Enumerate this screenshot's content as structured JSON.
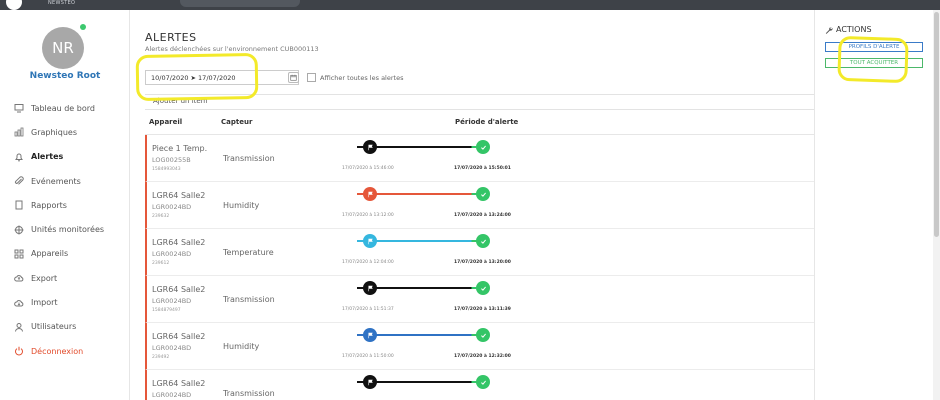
{
  "app": {
    "brand": "NEWSTEO"
  },
  "user": {
    "initials": "NR",
    "name": "Newsteo Root"
  },
  "nav": [
    {
      "label": "Tableau de bord",
      "icon": "monitor-icon",
      "name": "sidebar-item-dashboard"
    },
    {
      "label": "Graphiques",
      "icon": "bar-chart-icon",
      "name": "sidebar-item-graphs"
    },
    {
      "label": "Alertes",
      "icon": "bell-icon",
      "name": "sidebar-item-alerts",
      "active": true
    },
    {
      "label": "Evénements",
      "icon": "paperclip-icon",
      "name": "sidebar-item-events"
    },
    {
      "label": "Rapports",
      "icon": "document-icon",
      "name": "sidebar-item-reports"
    },
    {
      "label": "Unités monitorées",
      "icon": "crosshair-icon",
      "name": "sidebar-item-units"
    },
    {
      "label": "Appareils",
      "icon": "grid-icon",
      "name": "sidebar-item-devices"
    },
    {
      "label": "Export",
      "icon": "cloud-upload-icon",
      "name": "sidebar-item-export"
    },
    {
      "label": "Import",
      "icon": "cloud-download-icon",
      "name": "sidebar-item-import"
    },
    {
      "label": "Utilisateurs",
      "icon": "user-icon",
      "name": "sidebar-item-users"
    },
    {
      "label": "Déconnexion",
      "icon": "power-icon",
      "name": "sidebar-item-logout",
      "logout": true
    }
  ],
  "main": {
    "title": "ALERTES",
    "subtitle": "Alertes déclenchées sur l'environnement CUB000113",
    "date_range": "10/07/2020 ➤ 17/07/2020",
    "show_all_label": "Afficher toutes les alertes",
    "add_item": "Ajouter un item",
    "columns": {
      "device": "Appareil",
      "sensor": "Capteur",
      "period": "Période d'alerte"
    }
  },
  "alerts": [
    {
      "device": "Piece 1 Temp.",
      "code": "LOG00255B",
      "id": "1584993043",
      "sensor": "Transmission",
      "start_color": "#111111",
      "line_color": "#111111",
      "start": "17/07/2020 à 15:46:00",
      "end": "17/07/2020 à 15:50:01"
    },
    {
      "device": "LGR64 Salle2",
      "code": "LGR0024BD",
      "id": "239632",
      "sensor": "Humidity",
      "start_color": "#e5573a",
      "line_color": "#e5573a",
      "start": "17/07/2020 à 13:12:00",
      "end": "17/07/2020 à 13:24:00"
    },
    {
      "device": "LGR64 Salle2",
      "code": "LGR0024BD",
      "id": "239612",
      "sensor": "Temperature",
      "start_color": "#35b7df",
      "line_color": "#35b7df",
      "start": "17/07/2020 à 12:04:00",
      "end": "17/07/2020 à 13:20:00"
    },
    {
      "device": "LGR64 Salle2",
      "code": "LGR0024BD",
      "id": "1584879497",
      "sensor": "Transmission",
      "start_color": "#111111",
      "line_color": "#111111",
      "start": "17/07/2020 à 11:51:37",
      "end": "17/07/2020 à 13:11:39"
    },
    {
      "device": "LGR64 Salle2",
      "code": "LGR0024BD",
      "id": "239492",
      "sensor": "Humidity",
      "start_color": "#2f72c4",
      "line_color": "#2f72c4",
      "start": "17/07/2020 à 11:50:00",
      "end": "17/07/2020 à 12:32:00"
    },
    {
      "device": "LGR64 Salle2",
      "code": "LGR0024BD",
      "id": "",
      "sensor": "Transmission",
      "start_color": "#111111",
      "line_color": "#111111",
      "start": "",
      "end": ""
    }
  ],
  "actions": {
    "title": "ACTIONS",
    "profiles_label": "PROFILS D'ALERTE",
    "ack_all_label": "TOUT ACQUITTER"
  },
  "colors": {
    "accent": "#2f76b6",
    "success": "#34c567",
    "danger": "#e5573a",
    "highlighter": "#f3ea2a"
  }
}
